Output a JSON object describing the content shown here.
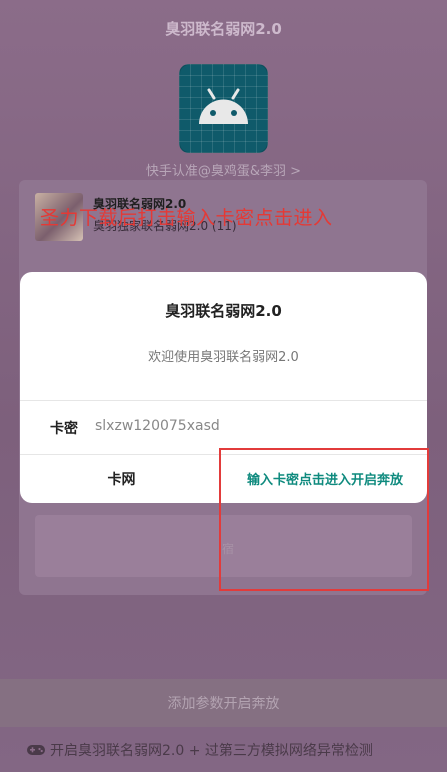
{
  "app": {
    "title": "臭羽联名弱网2.0",
    "subtitle_link": "快手认准@臭鸡蛋&李羽 >"
  },
  "song": {
    "title": "臭羽联名弱网2.0",
    "subtitle": "臭羽独家联名弱网2.0 (11)"
  },
  "banner": "圣力下载后打击输入卡密点击进入",
  "dialog": {
    "title": "臭羽联名弱网2.0",
    "message": "欢迎使用臭羽联名弱网2.0",
    "field_label": "卡密",
    "field_value": "slxzw120075xasd",
    "left_button": "卡网",
    "right_button": "输入卡密点击进入开启奔放"
  },
  "background_input_char": "宿",
  "bottom_button": "添加参数开启奔放",
  "footer": "开启臭羽联名弱网2.0 + 过第三方模拟网络异常检测",
  "icons": {
    "app": "android-robot-icon",
    "footer": "gamepad-icon"
  },
  "colors": {
    "accent": "#0e8a7e",
    "highlight": "#e23b3b",
    "banner": "#e53935"
  }
}
